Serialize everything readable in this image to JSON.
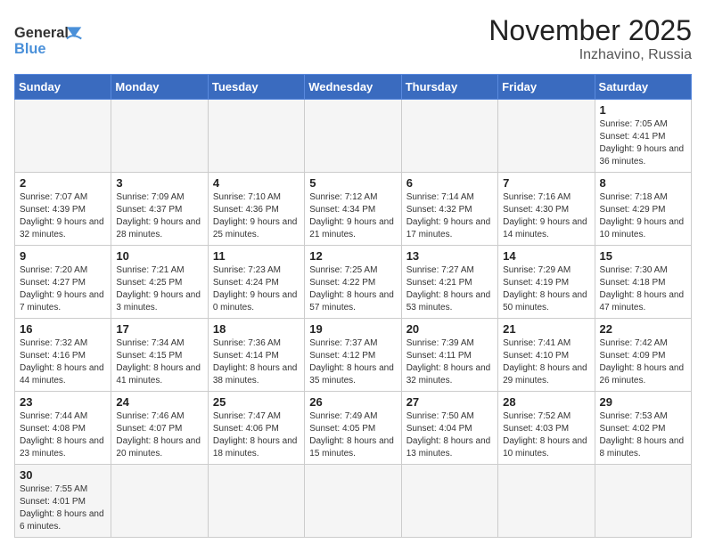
{
  "header": {
    "logo_general": "General",
    "logo_blue": "Blue",
    "title": "November 2025",
    "subtitle": "Inzhavino, Russia"
  },
  "weekdays": [
    "Sunday",
    "Monday",
    "Tuesday",
    "Wednesday",
    "Thursday",
    "Friday",
    "Saturday"
  ],
  "weeks": [
    [
      {
        "day": "",
        "info": "",
        "empty": true
      },
      {
        "day": "",
        "info": "",
        "empty": true
      },
      {
        "day": "",
        "info": "",
        "empty": true
      },
      {
        "day": "",
        "info": "",
        "empty": true
      },
      {
        "day": "",
        "info": "",
        "empty": true
      },
      {
        "day": "",
        "info": "",
        "empty": true
      },
      {
        "day": "1",
        "info": "Sunrise: 7:05 AM\nSunset: 4:41 PM\nDaylight: 9 hours and 36 minutes."
      }
    ],
    [
      {
        "day": "2",
        "info": "Sunrise: 7:07 AM\nSunset: 4:39 PM\nDaylight: 9 hours and 32 minutes."
      },
      {
        "day": "3",
        "info": "Sunrise: 7:09 AM\nSunset: 4:37 PM\nDaylight: 9 hours and 28 minutes."
      },
      {
        "day": "4",
        "info": "Sunrise: 7:10 AM\nSunset: 4:36 PM\nDaylight: 9 hours and 25 minutes."
      },
      {
        "day": "5",
        "info": "Sunrise: 7:12 AM\nSunset: 4:34 PM\nDaylight: 9 hours and 21 minutes."
      },
      {
        "day": "6",
        "info": "Sunrise: 7:14 AM\nSunset: 4:32 PM\nDaylight: 9 hours and 17 minutes."
      },
      {
        "day": "7",
        "info": "Sunrise: 7:16 AM\nSunset: 4:30 PM\nDaylight: 9 hours and 14 minutes."
      },
      {
        "day": "8",
        "info": "Sunrise: 7:18 AM\nSunset: 4:29 PM\nDaylight: 9 hours and 10 minutes."
      }
    ],
    [
      {
        "day": "9",
        "info": "Sunrise: 7:20 AM\nSunset: 4:27 PM\nDaylight: 9 hours and 7 minutes."
      },
      {
        "day": "10",
        "info": "Sunrise: 7:21 AM\nSunset: 4:25 PM\nDaylight: 9 hours and 3 minutes."
      },
      {
        "day": "11",
        "info": "Sunrise: 7:23 AM\nSunset: 4:24 PM\nDaylight: 9 hours and 0 minutes."
      },
      {
        "day": "12",
        "info": "Sunrise: 7:25 AM\nSunset: 4:22 PM\nDaylight: 8 hours and 57 minutes."
      },
      {
        "day": "13",
        "info": "Sunrise: 7:27 AM\nSunset: 4:21 PM\nDaylight: 8 hours and 53 minutes."
      },
      {
        "day": "14",
        "info": "Sunrise: 7:29 AM\nSunset: 4:19 PM\nDaylight: 8 hours and 50 minutes."
      },
      {
        "day": "15",
        "info": "Sunrise: 7:30 AM\nSunset: 4:18 PM\nDaylight: 8 hours and 47 minutes."
      }
    ],
    [
      {
        "day": "16",
        "info": "Sunrise: 7:32 AM\nSunset: 4:16 PM\nDaylight: 8 hours and 44 minutes."
      },
      {
        "day": "17",
        "info": "Sunrise: 7:34 AM\nSunset: 4:15 PM\nDaylight: 8 hours and 41 minutes."
      },
      {
        "day": "18",
        "info": "Sunrise: 7:36 AM\nSunset: 4:14 PM\nDaylight: 8 hours and 38 minutes."
      },
      {
        "day": "19",
        "info": "Sunrise: 7:37 AM\nSunset: 4:12 PM\nDaylight: 8 hours and 35 minutes."
      },
      {
        "day": "20",
        "info": "Sunrise: 7:39 AM\nSunset: 4:11 PM\nDaylight: 8 hours and 32 minutes."
      },
      {
        "day": "21",
        "info": "Sunrise: 7:41 AM\nSunset: 4:10 PM\nDaylight: 8 hours and 29 minutes."
      },
      {
        "day": "22",
        "info": "Sunrise: 7:42 AM\nSunset: 4:09 PM\nDaylight: 8 hours and 26 minutes."
      }
    ],
    [
      {
        "day": "23",
        "info": "Sunrise: 7:44 AM\nSunset: 4:08 PM\nDaylight: 8 hours and 23 minutes."
      },
      {
        "day": "24",
        "info": "Sunrise: 7:46 AM\nSunset: 4:07 PM\nDaylight: 8 hours and 20 minutes."
      },
      {
        "day": "25",
        "info": "Sunrise: 7:47 AM\nSunset: 4:06 PM\nDaylight: 8 hours and 18 minutes."
      },
      {
        "day": "26",
        "info": "Sunrise: 7:49 AM\nSunset: 4:05 PM\nDaylight: 8 hours and 15 minutes."
      },
      {
        "day": "27",
        "info": "Sunrise: 7:50 AM\nSunset: 4:04 PM\nDaylight: 8 hours and 13 minutes."
      },
      {
        "day": "28",
        "info": "Sunrise: 7:52 AM\nSunset: 4:03 PM\nDaylight: 8 hours and 10 minutes."
      },
      {
        "day": "29",
        "info": "Sunrise: 7:53 AM\nSunset: 4:02 PM\nDaylight: 8 hours and 8 minutes."
      }
    ],
    [
      {
        "day": "30",
        "info": "Sunrise: 7:55 AM\nSunset: 4:01 PM\nDaylight: 8 hours and 6 minutes.",
        "last": true
      },
      {
        "day": "",
        "info": "",
        "empty": true,
        "last": true
      },
      {
        "day": "",
        "info": "",
        "empty": true,
        "last": true
      },
      {
        "day": "",
        "info": "",
        "empty": true,
        "last": true
      },
      {
        "day": "",
        "info": "",
        "empty": true,
        "last": true
      },
      {
        "day": "",
        "info": "",
        "empty": true,
        "last": true
      },
      {
        "day": "",
        "info": "",
        "empty": true,
        "last": true
      }
    ]
  ]
}
